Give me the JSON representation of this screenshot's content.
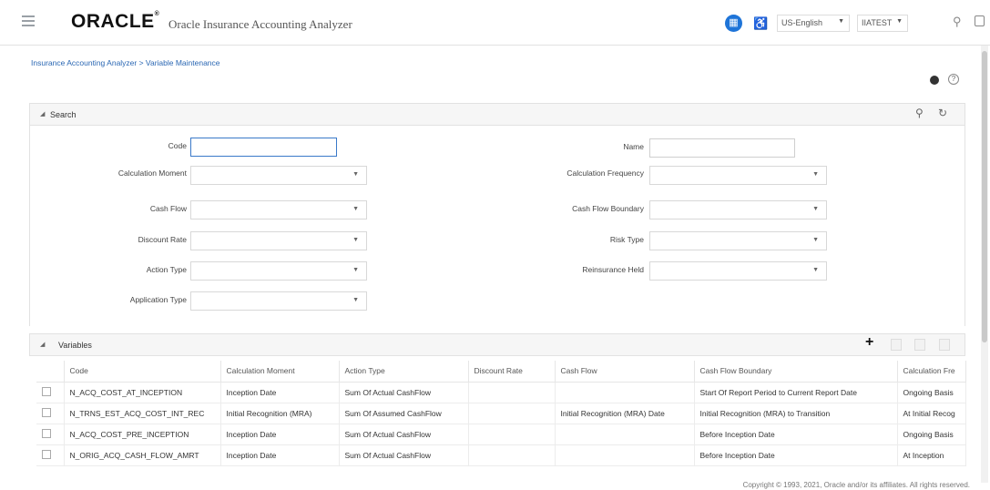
{
  "header": {
    "logo": "ORACLE",
    "app_title": "Oracle Insurance Accounting Analyzer",
    "language": "US-English",
    "user": "IIATEST"
  },
  "breadcrumb": "Insurance Accounting Analyzer > Variable Maintenance",
  "search": {
    "title": "Search",
    "fields": {
      "code": {
        "label": "Code",
        "value": ""
      },
      "name": {
        "label": "Name",
        "value": ""
      },
      "calculation_moment": {
        "label": "Calculation Moment",
        "value": ""
      },
      "calculation_frequency": {
        "label": "Calculation Frequency",
        "value": ""
      },
      "cash_flow": {
        "label": "Cash Flow",
        "value": ""
      },
      "cash_flow_boundary": {
        "label": "Cash Flow Boundary",
        "value": ""
      },
      "discount_rate": {
        "label": "Discount Rate",
        "value": ""
      },
      "risk_type": {
        "label": "Risk Type",
        "value": ""
      },
      "action_type": {
        "label": "Action Type",
        "value": ""
      },
      "reinsurance_held": {
        "label": "Reinsurance Held",
        "value": ""
      },
      "application_type": {
        "label": "Application Type",
        "value": ""
      }
    }
  },
  "variables": {
    "title": "Variables",
    "columns": [
      "Code",
      "Calculation Moment",
      "Action Type",
      "Discount Rate",
      "Cash Flow",
      "Cash Flow Boundary",
      "Calculation Fre"
    ],
    "rows": [
      [
        "N_ACQ_COST_AT_INCEPTION",
        "Inception Date",
        "Sum Of Actual CashFlow",
        "",
        "",
        "Start Of Report Period to Current Report Date",
        "Ongoing Basis"
      ],
      [
        "N_TRNS_EST_ACQ_COST_INT_REC",
        "Initial Recognition (MRA)",
        "Sum Of Assumed CashFlow",
        "",
        "Initial Recognition (MRA) Date",
        "Initial Recognition (MRA) to Transition",
        "At Initial Recog"
      ],
      [
        "N_ACQ_COST_PRE_INCEPTION",
        "Inception Date",
        "Sum Of Actual CashFlow",
        "",
        "",
        "Before Inception Date",
        "Ongoing Basis"
      ],
      [
        "N_ORIG_ACQ_CASH_FLOW_AMRT",
        "Inception Date",
        "Sum Of Actual CashFlow",
        "",
        "",
        "Before Inception Date",
        "At Inception"
      ]
    ]
  },
  "footer": {
    "copyright": "Copyright © 1993, 2021, Oracle and/or its affiliates. All rights reserved."
  }
}
